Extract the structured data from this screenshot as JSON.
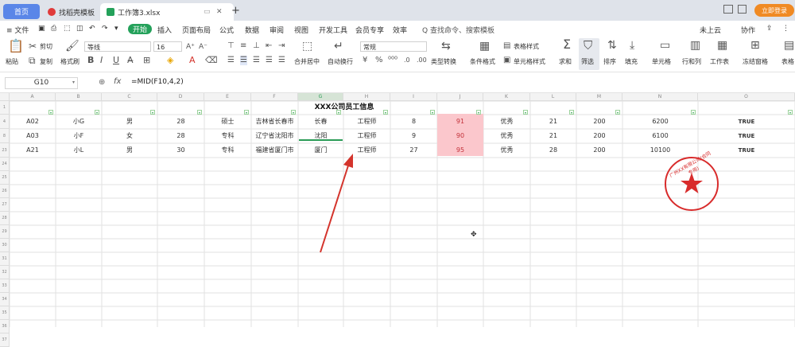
{
  "titlebar": {
    "home_tab": "首页",
    "template_tab": "找稻壳模板",
    "workbook_tab": "工作簿3.xlsx",
    "add_tab": "+",
    "login": "立即登录"
  },
  "menubar": {
    "file": "≡ 文件",
    "start": "开始",
    "items": [
      "插入",
      "页面布局",
      "公式",
      "数据",
      "审阅",
      "视图",
      "开发工具",
      "会员专享",
      "效率"
    ],
    "search": "Q 查找命令、搜索模板",
    "cloud": "未上云",
    "collab": "协作"
  },
  "toolbar": {
    "paste": "粘贴",
    "cut": "剪切",
    "copy": "复制",
    "format_painter": "格式刷",
    "font_name": "等线",
    "font_size": "16",
    "merge": "合并居中",
    "wrap": "自动换行",
    "number_format": "常规",
    "type_convert": "类型转换",
    "cond_format": "条件格式",
    "table_style": "表格样式",
    "cell_style": "单元格样式",
    "sum": "求和",
    "filter": "筛选",
    "sort": "排序",
    "fill": "填充",
    "cell": "单元格",
    "row_col": "行和列",
    "sheet": "工作表",
    "freeze": "冻结窗格",
    "table_tools": "表格"
  },
  "formulabar": {
    "name_box": "G10",
    "fx": "fx",
    "formula": "=MID(F10,4,2)"
  },
  "columns": [
    "A",
    "B",
    "C",
    "D",
    "E",
    "F",
    "G",
    "H",
    "I",
    "J",
    "K",
    "L",
    "M",
    "N",
    "O"
  ],
  "rows": [
    "1",
    "4",
    "8",
    "23",
    "24",
    "25",
    "26",
    "27",
    "28",
    "29",
    "30",
    "31",
    "32",
    "33",
    "34",
    "35",
    "36",
    "37"
  ],
  "title_cell": "XXX公司员工信息",
  "data_rows": [
    [
      "A02",
      "小G",
      "男",
      "28",
      "硕士",
      "吉林省长春市",
      "长春",
      "工程师",
      "8",
      "91",
      "优秀",
      "21",
      "200",
      "6200",
      "TRUE"
    ],
    [
      "A03",
      "小F",
      "女",
      "28",
      "专科",
      "辽宁省沈阳市",
      "沈阳",
      "工程师",
      "9",
      "90",
      "优秀",
      "21",
      "200",
      "6100",
      "TRUE"
    ],
    [
      "A21",
      "小L",
      "男",
      "30",
      "专科",
      "福建省厦门市",
      "厦门",
      "工程师",
      "27",
      "95",
      "优秀",
      "28",
      "200",
      "10100",
      "TRUE"
    ]
  ],
  "colors": {
    "accent_green": "#24a15a",
    "highlight_red": "#fbc7cc",
    "arrow_red": "#d4342c",
    "stamp_red": "#d82b2b"
  },
  "stamp_text": "广州XX有限公司(合同专用)"
}
